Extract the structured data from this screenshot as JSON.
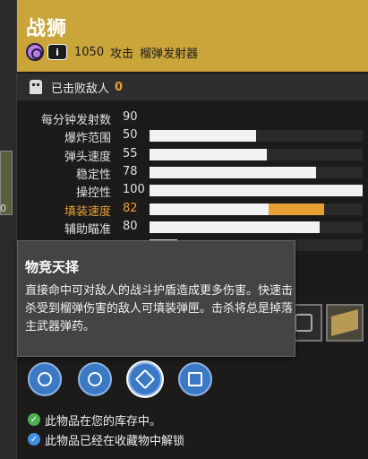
{
  "background": {
    "frag_number": "0"
  },
  "weapon": {
    "name": "战狮",
    "damage_icon": "void-damage-icon",
    "ammo_icon": "special-ammo-icon",
    "ammo_symbol": "i",
    "power": "1050",
    "power_label": "攻击",
    "type": "榴弹发射器",
    "header_color": "#c9a53a"
  },
  "kills": {
    "label": "已击败敌人",
    "count": "0",
    "icon": "ghost-icon"
  },
  "stats": [
    {
      "label": "每分钟发射数",
      "value": "90",
      "bar": null
    },
    {
      "label": "爆炸范围",
      "value": "50",
      "bar": 0.5
    },
    {
      "label": "弹头速度",
      "value": "55",
      "bar": 0.55
    },
    {
      "label": "稳定性",
      "value": "78",
      "bar": 0.78
    },
    {
      "label": "操控性",
      "value": "100",
      "bar": 1.0
    },
    {
      "label": "填装速度",
      "value": "82",
      "bar": 0.56,
      "bonus": 0.26,
      "highlight": true
    },
    {
      "label": "辅助瞄准",
      "value": "80",
      "bar": 0.8
    },
    {
      "label": "",
      "value": "",
      "bar": 0.13
    }
  ],
  "tooltip": {
    "title": "物竞天择",
    "body": "直接命中可对敌人的战斗护盾造成更多伤害。快速击杀受到榴弹伤害的敌人可填装弹匣。击杀将总是掉落主武器弹药。"
  },
  "perks_right": [
    {
      "icon": "perk-frame-icon"
    },
    {
      "icon": "weapon-ornament-icon"
    }
  ],
  "traits": [
    {
      "icon": "flame-burst-icon"
    },
    {
      "icon": "crosshair-target-icon"
    },
    {
      "icon": "tiger-claw-icon"
    },
    {
      "icon": "mag-flag-icon"
    }
  ],
  "notes": [
    {
      "text": "此物品在您的库存中。",
      "color": "#4caf50"
    },
    {
      "text": "此物品已经在收藏物中解锁",
      "color": "#3f8fe0"
    }
  ]
}
